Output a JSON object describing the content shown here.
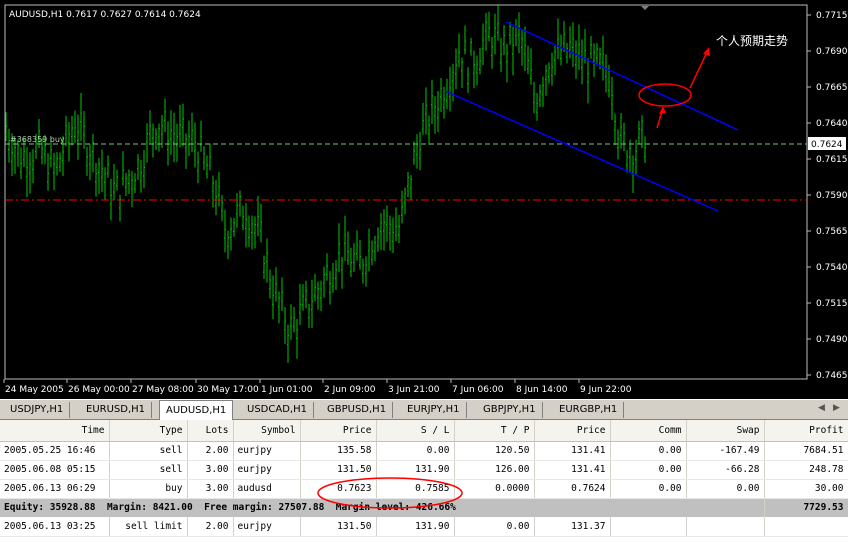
{
  "chart": {
    "title": "AUDUSD,H1  0.7617 0.7627 0.7614 0.7624",
    "order_label": "#368359 buy",
    "annotation": "个人预期走势",
    "current_price": "0.7624",
    "price_ticks": [
      "0.7715",
      "0.7690",
      "0.7665",
      "0.7640",
      "0.7615",
      "0.7590",
      "0.7565",
      "0.7540",
      "0.7515",
      "0.7490",
      "0.7465"
    ],
    "time_ticks": [
      "24 May 2005",
      "26 May 00:00",
      "27 May 08:00",
      "30 May 17:00",
      "1 Jun 01:00",
      "2 Jun 09:00",
      "3 Jun 21:00",
      "7 Jun 06:00",
      "8 Jun 14:00",
      "9 Jun 22:00"
    ],
    "colors": {
      "background": "#000000",
      "bars": "#00c800",
      "channel": "#0000ff",
      "entry_line": "#7fbf7f",
      "stop_line": "#ff0000",
      "annotation": "#ff0000"
    }
  },
  "tabs": {
    "items": [
      "USDJPY,H1",
      "EURUSD,H1",
      "AUDUSD,H1",
      "USDCAD,H1",
      "GBPUSD,H1",
      "EURJPY,H1",
      "GBPJPY,H1",
      "EURGBP,H1"
    ],
    "active": "AUDUSD,H1"
  },
  "terminal": {
    "columns": [
      "Time",
      "Type",
      "Lots",
      "Symbol",
      "Price",
      "S / L",
      "T / P",
      "Price",
      "Comm",
      "Swap",
      "Profit"
    ],
    "rows": [
      [
        "2005.05.25 16:46",
        "sell",
        "2.00",
        "eurjpy",
        "135.58",
        "0.00",
        "120.50",
        "131.41",
        "0.00",
        "-167.49",
        "7684.51"
      ],
      [
        "2005.06.08 05:15",
        "sell",
        "3.00",
        "eurjpy",
        "131.50",
        "131.90",
        "126.00",
        "131.41",
        "0.00",
        "-66.28",
        "248.78"
      ],
      [
        "2005.06.13 06:29",
        "buy",
        "3.00",
        "audusd",
        "0.7623",
        "0.7585",
        "0.0000",
        "0.7624",
        "0.00",
        "0.00",
        "30.00"
      ]
    ],
    "summary": {
      "text": "Equity: 35928.88  Margin: 8421.00  Free margin: 27507.88  Margin level: 426.66%",
      "profit": "7729.53"
    },
    "pending": [
      "2005.06.13 03:25",
      "sell limit",
      "2.00",
      "eurjpy",
      "131.50",
      "131.90",
      "0.00",
      "131.37",
      "",
      "",
      ""
    ]
  }
}
